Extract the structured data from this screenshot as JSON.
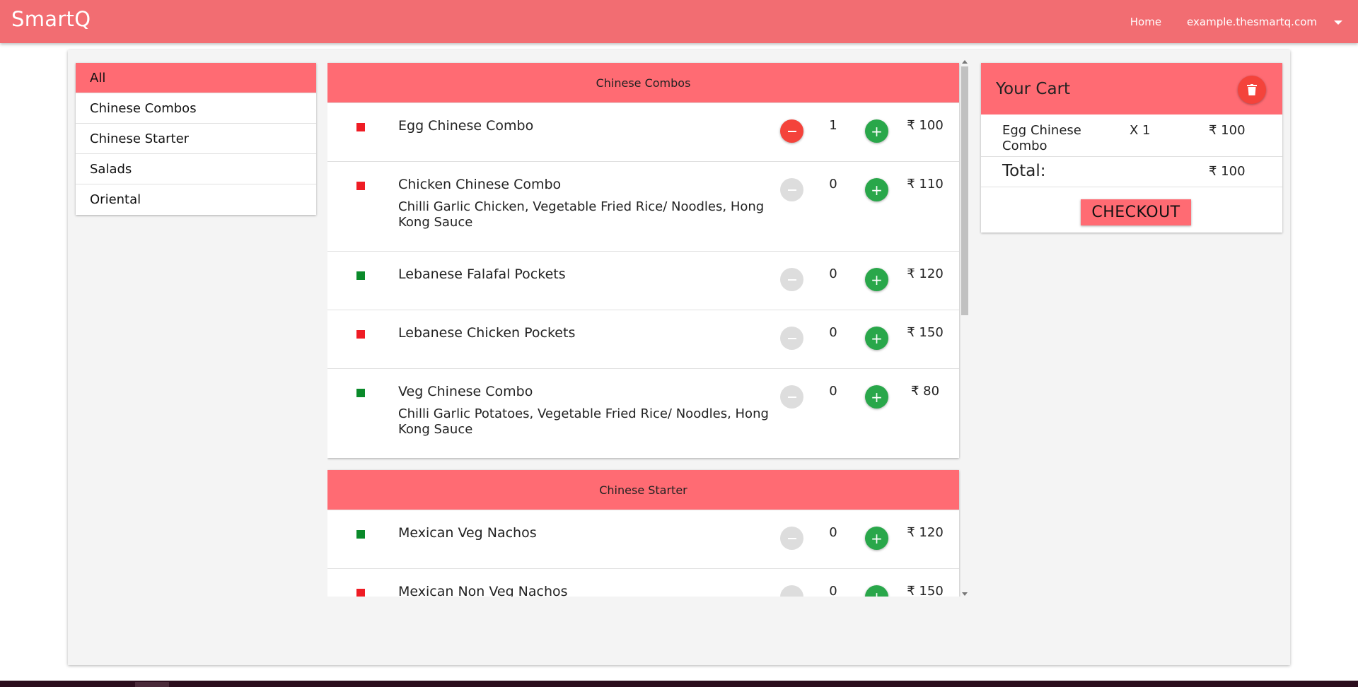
{
  "app": {
    "brand": "SmartQ"
  },
  "nav": {
    "home": "Home",
    "account": "example.thesmartq.com"
  },
  "colors": {
    "primary": "#f26d72",
    "accent": "#ff6b73",
    "add": "#29a74a",
    "remove": "#f4433b",
    "veg": "#0a8a2a",
    "nonveg": "#ef1c24"
  },
  "categories": [
    {
      "label": "All",
      "active": true
    },
    {
      "label": "Chinese Combos",
      "active": false
    },
    {
      "label": "Chinese Starter",
      "active": false
    },
    {
      "label": "Salads",
      "active": false
    },
    {
      "label": "Oriental",
      "active": false
    }
  ],
  "sections": [
    {
      "title": "Chinese Combos",
      "items": [
        {
          "name": "Egg Chinese Combo",
          "description": "",
          "type": "nonveg",
          "qty": "1",
          "price": "₹ 100"
        },
        {
          "name": "Chicken Chinese Combo",
          "description": "Chilli Garlic Chicken, Vegetable Fried Rice/ Noodles, Hong Kong Sauce",
          "type": "nonveg",
          "qty": "0",
          "price": "₹ 110"
        },
        {
          "name": "Lebanese Falafal Pockets",
          "description": "",
          "type": "veg",
          "qty": "0",
          "price": "₹ 120"
        },
        {
          "name": "Lebanese Chicken Pockets",
          "description": "",
          "type": "nonveg",
          "qty": "0",
          "price": "₹ 150"
        },
        {
          "name": "Veg Chinese Combo",
          "description": "Chilli Garlic Potatoes, Vegetable Fried Rice/ Noodles, Hong Kong Sauce",
          "type": "veg",
          "qty": "0",
          "price": "₹ 80"
        }
      ]
    },
    {
      "title": "Chinese Starter",
      "items": [
        {
          "name": "Mexican Veg Nachos",
          "description": "",
          "type": "veg",
          "qty": "0",
          "price": "₹ 120"
        },
        {
          "name": "Mexican Non Veg Nachos",
          "description": "",
          "type": "nonveg",
          "qty": "0",
          "price": "₹ 150"
        }
      ]
    }
  ],
  "cart": {
    "title": "Your Cart",
    "items": [
      {
        "name": "Egg Chinese Combo",
        "qty": "X 1",
        "price": "₹ 100"
      }
    ],
    "total_label": "Total:",
    "total_value": "₹ 100",
    "checkout_label": "CHECKOUT"
  }
}
